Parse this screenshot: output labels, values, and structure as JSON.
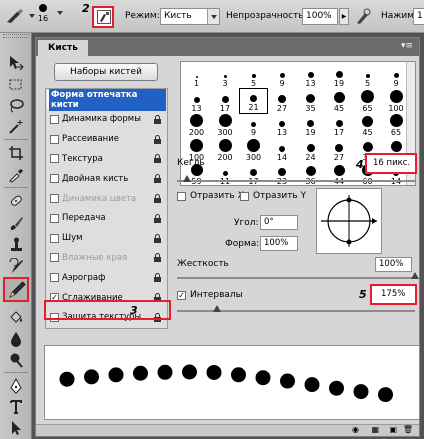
{
  "options_bar": {
    "brush_size": "16",
    "mode_label": "Режим:",
    "mode_value": "Кисть",
    "opacity_label": "Непрозрачность:",
    "opacity_value": "100%",
    "pressure_label": "Нажим:",
    "pressure_value": "1"
  },
  "annotations": {
    "n2": "2",
    "n3": "3",
    "n4": "4",
    "n5": "5",
    "color": "#e0202a"
  },
  "panel": {
    "tab_label": "Кисть",
    "presets_button": "Наборы кистей",
    "options": [
      {
        "label": "Форма отпечатка кисти",
        "checked": null,
        "selected": true,
        "disabled": false,
        "lock": false
      },
      {
        "label": "Динамика формы",
        "checked": false,
        "selected": false,
        "disabled": false,
        "lock": true
      },
      {
        "label": "Рассеивание",
        "checked": false,
        "selected": false,
        "disabled": false,
        "lock": true
      },
      {
        "label": "Текстура",
        "checked": false,
        "selected": false,
        "disabled": false,
        "lock": true
      },
      {
        "label": "Двойная кисть",
        "checked": false,
        "selected": false,
        "disabled": false,
        "lock": true
      },
      {
        "label": "Динамика цвета",
        "checked": false,
        "selected": false,
        "disabled": true,
        "lock": true
      },
      {
        "label": "Передача",
        "checked": false,
        "selected": false,
        "disabled": false,
        "lock": true
      },
      {
        "label": "Шум",
        "checked": false,
        "selected": false,
        "disabled": false,
        "lock": true
      },
      {
        "label": "Влажные края",
        "checked": false,
        "selected": false,
        "disabled": true,
        "lock": true
      },
      {
        "label": "Аэрограф",
        "checked": false,
        "selected": false,
        "disabled": false,
        "lock": true
      },
      {
        "label": "Сглаживание",
        "checked": true,
        "selected": false,
        "disabled": false,
        "lock": true
      },
      {
        "label": "Защита текстуры",
        "checked": false,
        "selected": false,
        "disabled": false,
        "lock": true
      }
    ],
    "brush_grid": {
      "rows": [
        [
          "1",
          "3",
          "5",
          "9",
          "13",
          "19",
          "5",
          "9"
        ],
        [
          "13",
          "17",
          "21",
          "27",
          "35",
          "45",
          "65",
          "100"
        ],
        [
          "200",
          "300",
          "9",
          "13",
          "19",
          "17",
          "45",
          "65"
        ],
        [
          "100",
          "200",
          "300",
          "14",
          "24",
          "27",
          "39",
          "46"
        ],
        [
          "59",
          "11",
          "17",
          "23",
          "36",
          "44",
          "60",
          "14"
        ]
      ]
    },
    "size_label": "Кегль",
    "size_value": "16 пикс.",
    "flip_x_label": "Отразить X",
    "flip_y_label": "Отразить Y",
    "angle_label": "Угол:",
    "angle_value": "0°",
    "roundness_label": "Форма:",
    "roundness_value": "100%",
    "hardness_label": "Жесткость",
    "hardness_value": "100%",
    "spacing_checked": true,
    "spacing_label": "Интервалы",
    "spacing_value": "175%",
    "hardness_level": 1.0,
    "size_level": 0.04,
    "spacing_level": 0.17
  }
}
